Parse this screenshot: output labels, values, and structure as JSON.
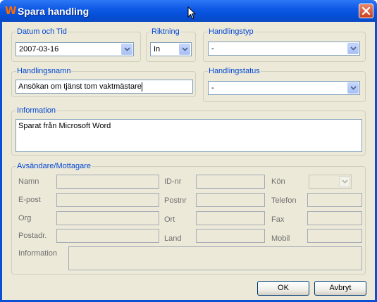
{
  "window": {
    "title": "Spara handling",
    "app_icon_letter": "W",
    "close_icon": "close-icon"
  },
  "datum": {
    "legend": "Datum och Tid",
    "value": "2007-03-16"
  },
  "riktning": {
    "legend": "Riktning",
    "value": "In"
  },
  "handlingstyp": {
    "legend": "Handlingstyp",
    "value": "-"
  },
  "handlingsnamn": {
    "legend": "Handlingsnamn",
    "value": "Ansökan om tjänst tom vaktmästare"
  },
  "handlingstatus": {
    "legend": "Handlingstatus",
    "value": "-"
  },
  "information": {
    "legend": "Information",
    "value": "Sparat från Microsoft Word"
  },
  "contact": {
    "legend": "Avsändare/Mottagare",
    "namn": "Namn",
    "epost": "E-post",
    "org": "Org",
    "postadr": "Postadr.",
    "idnr": "ID-nr",
    "postnr": "Postnr",
    "ort": "Ort",
    "land": "Land",
    "kon": "Kön",
    "telefon": "Telefon",
    "fax": "Fax",
    "mobil": "Mobil",
    "information": "Information"
  },
  "buttons": {
    "ok": "OK",
    "cancel": "Avbryt"
  },
  "colors": {
    "titlebar": "#0a4fd6",
    "legend": "#0046d5",
    "dialog_bg": "#ece9d8",
    "close": "#c9401f"
  }
}
